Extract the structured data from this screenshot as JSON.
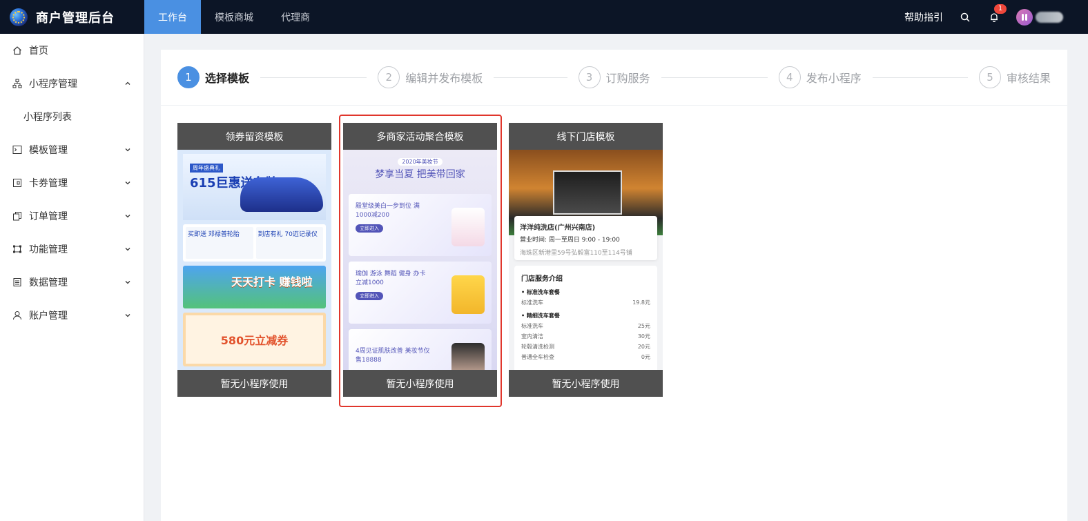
{
  "app": {
    "title": "商户管理后台"
  },
  "topnav": [
    {
      "label": "工作台",
      "active": true
    },
    {
      "label": "模板商城",
      "active": false
    },
    {
      "label": "代理商",
      "active": false
    }
  ],
  "topright": {
    "help": "帮助指引",
    "notifications": "1"
  },
  "sidebar": {
    "items": [
      {
        "label": "首页",
        "icon": "home-icon"
      },
      {
        "label": "小程序管理",
        "icon": "sitemap-icon",
        "expanded": true
      },
      {
        "label": "小程序列表",
        "sub": true
      },
      {
        "label": "模板管理",
        "icon": "terminal-icon"
      },
      {
        "label": "卡券管理",
        "icon": "card-icon"
      },
      {
        "label": "订单管理",
        "icon": "order-icon"
      },
      {
        "label": "功能管理",
        "icon": "function-icon"
      },
      {
        "label": "数据管理",
        "icon": "data-icon"
      },
      {
        "label": "账户管理",
        "icon": "user-icon"
      }
    ]
  },
  "steps": [
    {
      "num": "1",
      "label": "选择模板",
      "active": true
    },
    {
      "num": "2",
      "label": "编辑并发布模板"
    },
    {
      "num": "3",
      "label": "订购服务"
    },
    {
      "num": "4",
      "label": "发布小程序"
    },
    {
      "num": "5",
      "label": "审核结果"
    }
  ],
  "templates": [
    {
      "title": "领券留资模板",
      "footer": "暂无小程序使用",
      "thumb": {
        "tag": "周年盛典礼",
        "headline": "615巨惠送车牌",
        "row1a": "买即送 邓禄普轮胎",
        "row1b": "到店有礼 70迈记录仪",
        "game": "天天打卡 赚钱啦",
        "coupon": "580元立减券"
      }
    },
    {
      "title": "多商家活动聚合模板",
      "footer": "暂无小程序使用",
      "selected": true,
      "thumb": {
        "small": "2020年美妆节",
        "headline": "梦享当夏 把美带回家",
        "p1": "殿堂级美白一步到位 满1000减200",
        "p1btn": "立即进入",
        "p2": "瑜伽 游泳 舞蹈 健身 办卡立减1000",
        "p2btn": "立即进入",
        "p3": "4周见证肌肤改善 美妆节仅售18888"
      }
    },
    {
      "title": "线下门店模板",
      "footer": "暂无小程序使用",
      "thumb": {
        "store": "洋洋纯洗店(广州兴南店)",
        "hours": "营业时间: 周一至周日 9:00 - 19:00",
        "addr": "海珠区新港里59号弘毅富110至114号铺",
        "svc_title": "门店服务介绍",
        "s1": "• 标准洗车套餐",
        "s1a": "标准洗车",
        "s1ap": "19.8元",
        "s2": "• 精细洗车套餐",
        "s2a": "标准洗车",
        "s2ap": "25元",
        "s2b": "室内清洁",
        "s2bp": "30元",
        "s2c": "轮毂清洗检测",
        "s2cp": "20元",
        "s2d": "普通全车检查",
        "s2dp": "0元"
      }
    }
  ],
  "colors": {
    "topbar": "#0c1526",
    "accent": "#4a90e2",
    "selected_border": "#e0362c",
    "card_bar": "#505050"
  }
}
